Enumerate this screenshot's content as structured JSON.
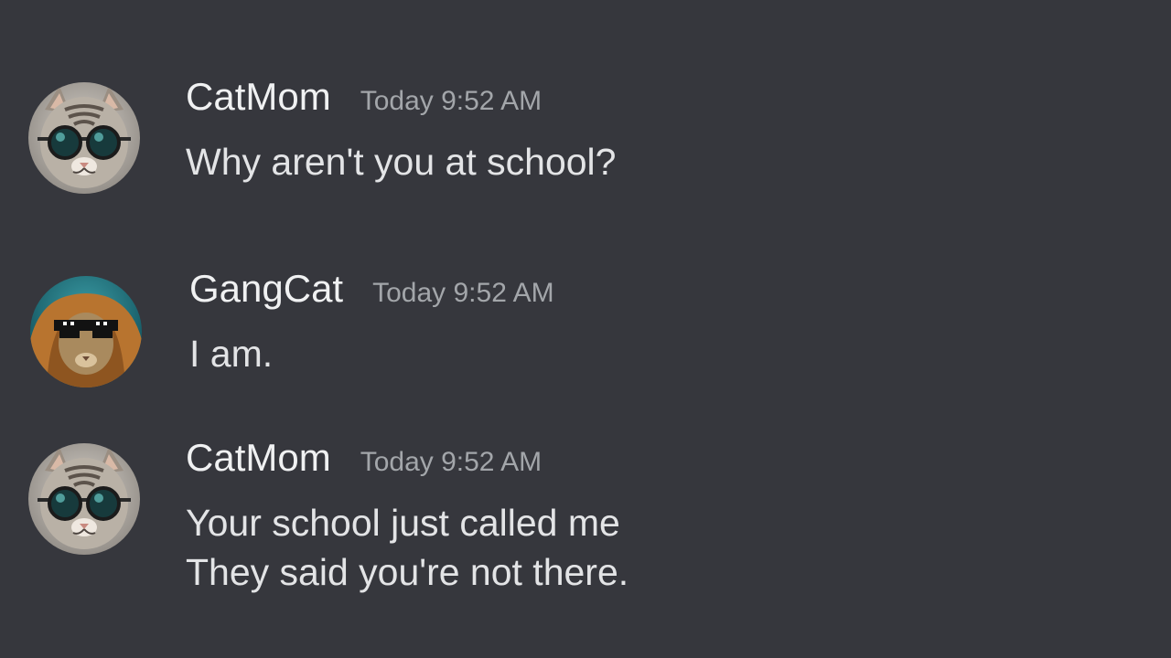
{
  "messages": [
    {
      "author": "CatMom",
      "timestamp": "Today 9:52 AM",
      "avatar_icon": "cat-with-round-sunglasses-avatar",
      "lines": [
        "Why aren't you at school?"
      ]
    },
    {
      "author": "GangCat",
      "timestamp": "Today 9:52 AM",
      "avatar_icon": "cat-in-hoodie-with-pixel-sunglasses-avatar",
      "lines": [
        "I am."
      ]
    },
    {
      "author": "CatMom",
      "timestamp": "Today 9:52 AM",
      "avatar_icon": "cat-with-round-sunglasses-avatar",
      "lines": [
        "Your school just called me",
        "They said you're not there."
      ]
    }
  ],
  "colors": {
    "background": "#36373d",
    "username": "#f0f1f2",
    "timestamp": "#a3a6aa",
    "message_text": "#e3e4e6"
  }
}
